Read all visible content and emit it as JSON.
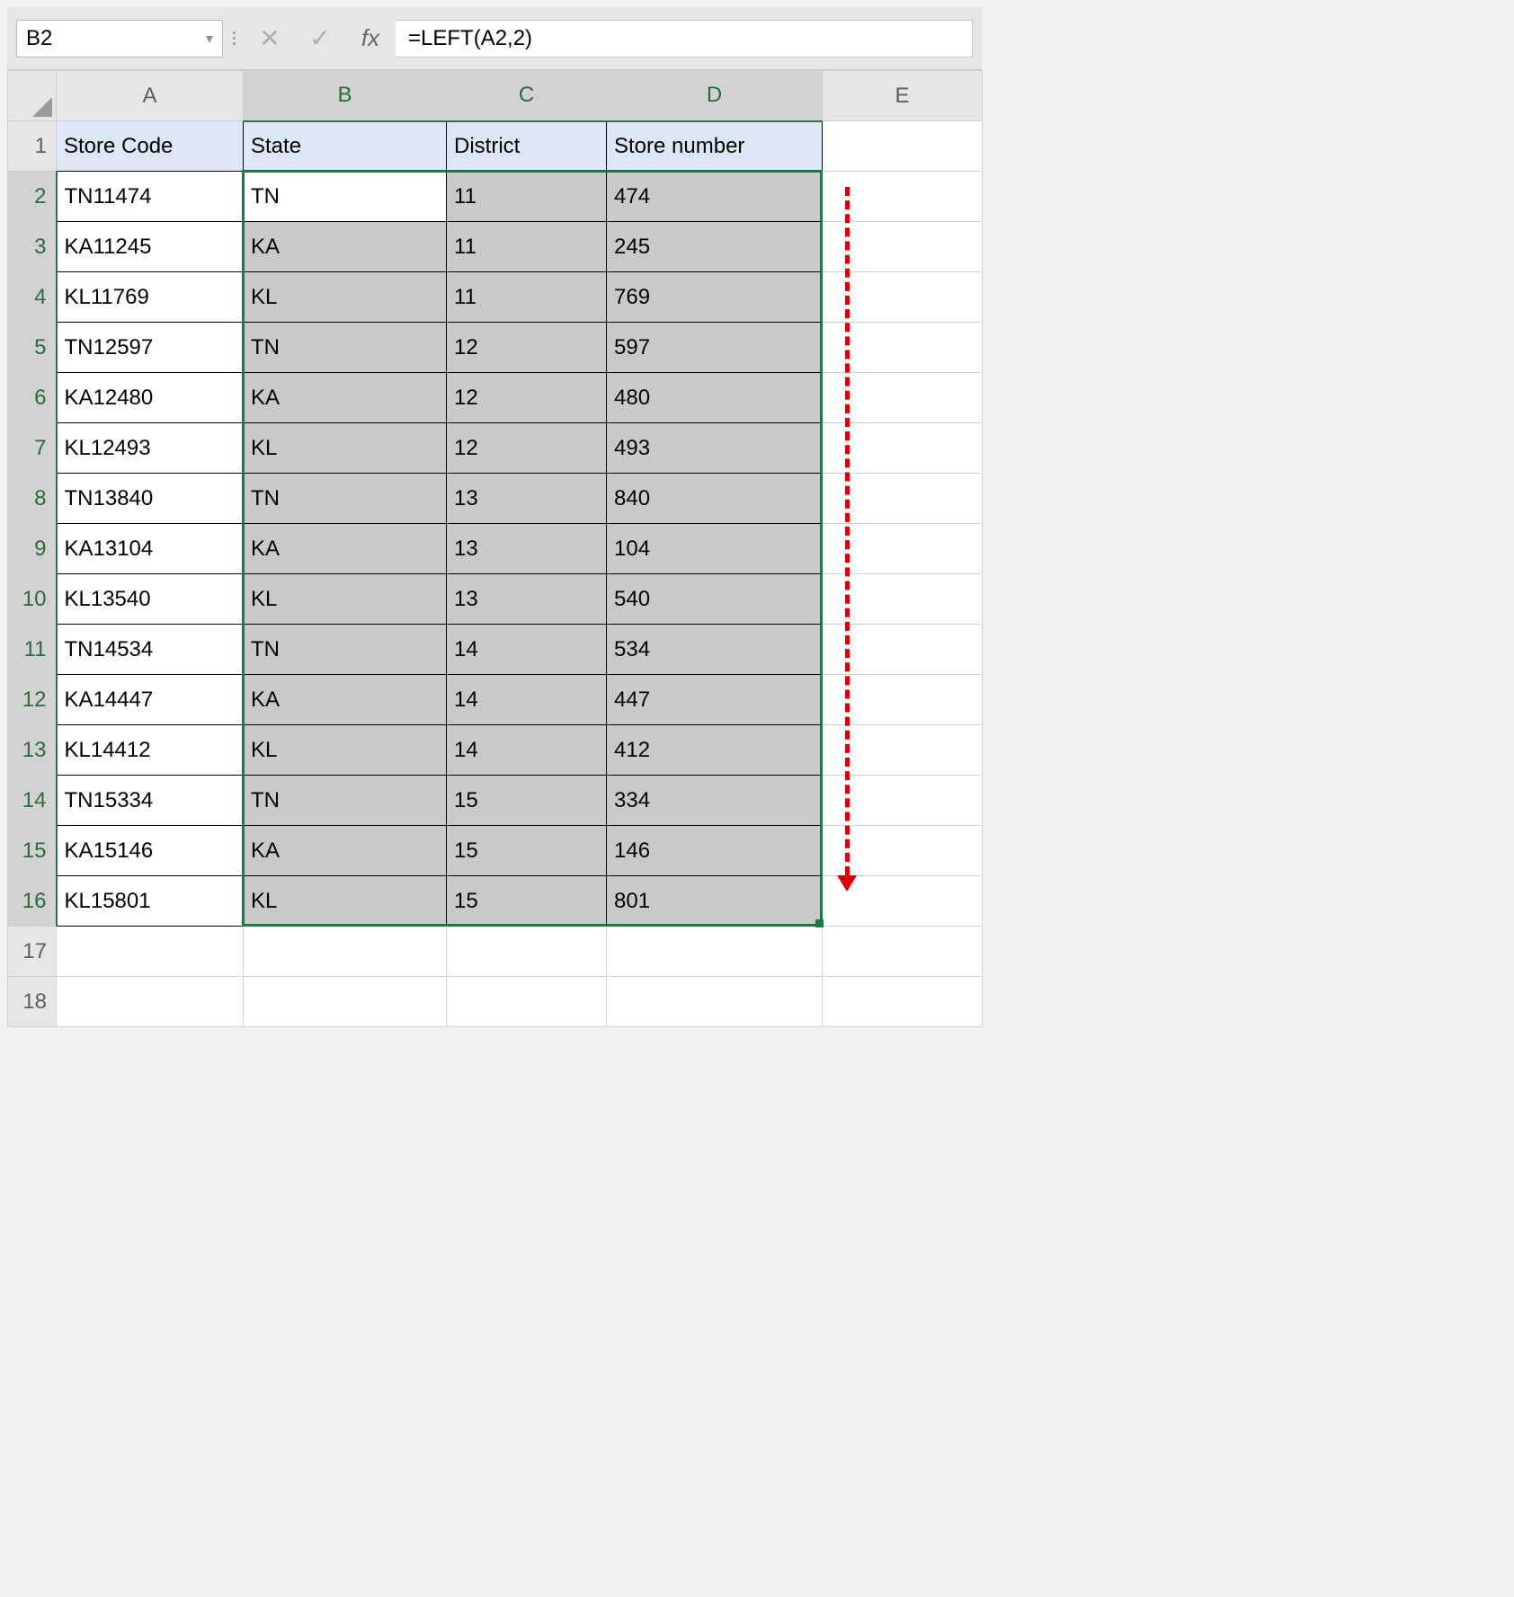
{
  "formula_bar": {
    "name_box_value": "B2",
    "dropdown_glyph": "▾",
    "cancel_glyph": "✕",
    "enter_glyph": "✓",
    "fx_label": "fx",
    "formula": "=LEFT(A2,2)"
  },
  "columns": [
    "A",
    "B",
    "C",
    "D",
    "E"
  ],
  "selected_columns": [
    "B",
    "C",
    "D"
  ],
  "column_headers": [
    "A",
    "B",
    "C",
    "D",
    "E"
  ],
  "row_numbers": [
    1,
    2,
    3,
    4,
    5,
    6,
    7,
    8,
    9,
    10,
    11,
    12,
    13,
    14,
    15,
    16,
    17,
    18
  ],
  "selected_rows": [
    2,
    3,
    4,
    5,
    6,
    7,
    8,
    9,
    10,
    11,
    12,
    13,
    14,
    15,
    16
  ],
  "active_cell": {
    "row": 2,
    "col": "B"
  },
  "table": {
    "headers": {
      "A": "Store Code",
      "B": "State",
      "C": "District",
      "D": "Store number"
    },
    "rows": [
      {
        "A": "TN11474",
        "B": "TN",
        "C": "11",
        "D": "474"
      },
      {
        "A": "KA11245",
        "B": "KA",
        "C": "11",
        "D": "245"
      },
      {
        "A": "KL11769",
        "B": "KL",
        "C": "11",
        "D": "769"
      },
      {
        "A": "TN12597",
        "B": "TN",
        "C": "12",
        "D": "597"
      },
      {
        "A": "KA12480",
        "B": "KA",
        "C": "12",
        "D": "480"
      },
      {
        "A": "KL12493",
        "B": "KL",
        "C": "12",
        "D": "493"
      },
      {
        "A": "TN13840",
        "B": "TN",
        "C": "13",
        "D": "840"
      },
      {
        "A": "KA13104",
        "B": "KA",
        "C": "13",
        "D": "104"
      },
      {
        "A": "KL13540",
        "B": "KL",
        "C": "13",
        "D": "540"
      },
      {
        "A": "TN14534",
        "B": "TN",
        "C": "14",
        "D": "534"
      },
      {
        "A": "KA14447",
        "B": "KA",
        "C": "14",
        "D": "447"
      },
      {
        "A": "KL14412",
        "B": "KL",
        "C": "14",
        "D": "412"
      },
      {
        "A": "TN15334",
        "B": "TN",
        "C": "15",
        "D": "334"
      },
      {
        "A": "KA15146",
        "B": "KA",
        "C": "15",
        "D": "146"
      },
      {
        "A": "KL15801",
        "B": "KL",
        "C": "15",
        "D": "801"
      }
    ]
  },
  "annotation": {
    "type": "dashed-arrow-down",
    "color": "#d60000"
  }
}
